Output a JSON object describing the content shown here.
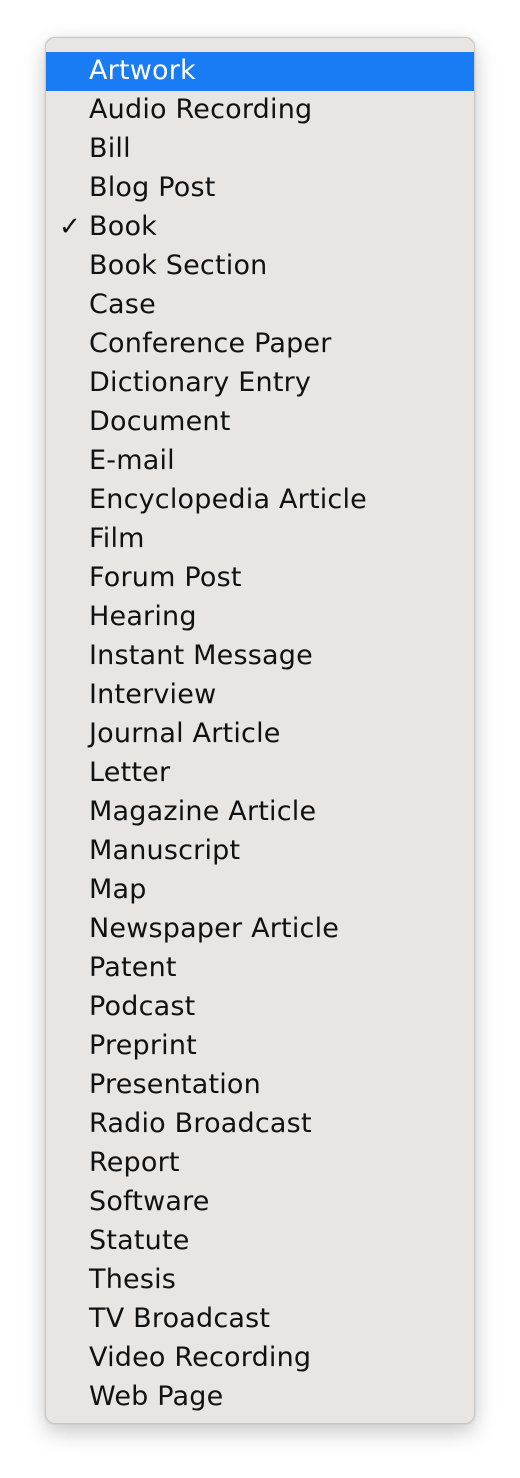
{
  "menu": {
    "highlight_color": "#1a7cf5",
    "checked_index": 4,
    "highlighted_index": 0,
    "check_glyph": "✓",
    "items": [
      {
        "label": "Artwork"
      },
      {
        "label": "Audio Recording"
      },
      {
        "label": "Bill"
      },
      {
        "label": "Blog Post"
      },
      {
        "label": "Book"
      },
      {
        "label": "Book Section"
      },
      {
        "label": "Case"
      },
      {
        "label": "Conference Paper"
      },
      {
        "label": "Dictionary Entry"
      },
      {
        "label": "Document"
      },
      {
        "label": "E-mail"
      },
      {
        "label": "Encyclopedia Article"
      },
      {
        "label": "Film"
      },
      {
        "label": "Forum Post"
      },
      {
        "label": "Hearing"
      },
      {
        "label": "Instant Message"
      },
      {
        "label": "Interview"
      },
      {
        "label": "Journal Article"
      },
      {
        "label": "Letter"
      },
      {
        "label": "Magazine Article"
      },
      {
        "label": "Manuscript"
      },
      {
        "label": "Map"
      },
      {
        "label": "Newspaper Article"
      },
      {
        "label": "Patent"
      },
      {
        "label": "Podcast"
      },
      {
        "label": "Preprint"
      },
      {
        "label": "Presentation"
      },
      {
        "label": "Radio Broadcast"
      },
      {
        "label": "Report"
      },
      {
        "label": "Software"
      },
      {
        "label": "Statute"
      },
      {
        "label": "Thesis"
      },
      {
        "label": "TV Broadcast"
      },
      {
        "label": "Video Recording"
      },
      {
        "label": "Web Page"
      }
    ]
  }
}
